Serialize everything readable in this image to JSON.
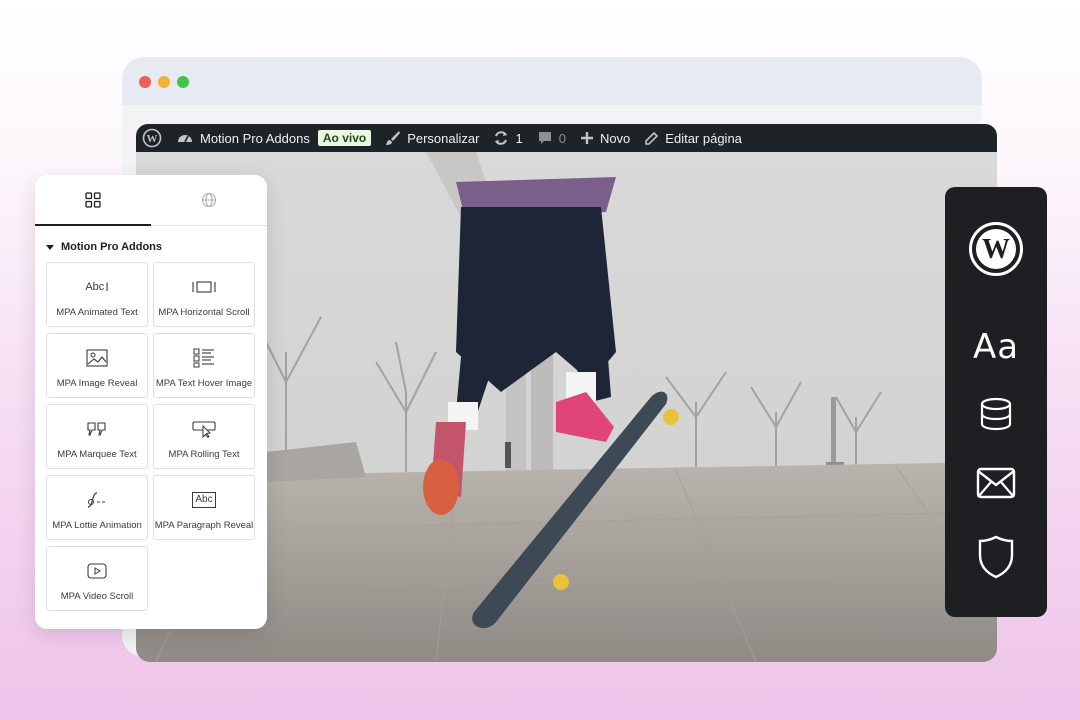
{
  "admin_bar": {
    "site_name": "Motion Pro Addons",
    "live_badge": "Ao vivo",
    "customize": "Personalizar",
    "updates_count": "1",
    "comments_count": "0",
    "new": "Novo",
    "edit_page": "Editar página"
  },
  "panel": {
    "section_title": "Motion Pro Addons",
    "widgets": [
      {
        "label": "MPA Animated Text",
        "icon": "text-cursor-icon",
        "glyph": "Abc"
      },
      {
        "label": "MPA Horizontal Scroll",
        "icon": "horizontal-scroll-icon"
      },
      {
        "label": "MPA Image Reveal",
        "icon": "image-icon"
      },
      {
        "label": "MPA Text Hover Image",
        "icon": "list-image-icon"
      },
      {
        "label": "MPA Marquee Text",
        "icon": "quote-icon"
      },
      {
        "label": "MPA Rolling Text",
        "icon": "pointer-box-icon"
      },
      {
        "label": "MPA Lottie Animation",
        "icon": "lottie-icon"
      },
      {
        "label": "MPA Paragraph Reveal",
        "icon": "abc-box-icon",
        "glyph": "Abc"
      },
      {
        "label": "MPA Video Scroll",
        "icon": "play-icon"
      }
    ]
  },
  "sidebar": {
    "icons": [
      "wordpress-icon",
      "typography-icon",
      "database-icon",
      "mail-icon",
      "shield-icon"
    ],
    "typography_glyph": "Aa"
  },
  "colors": {
    "admin_bar": "#1d2327",
    "sidebar": "#1e1f22",
    "live_badge_bg": "#e9f7e4"
  }
}
